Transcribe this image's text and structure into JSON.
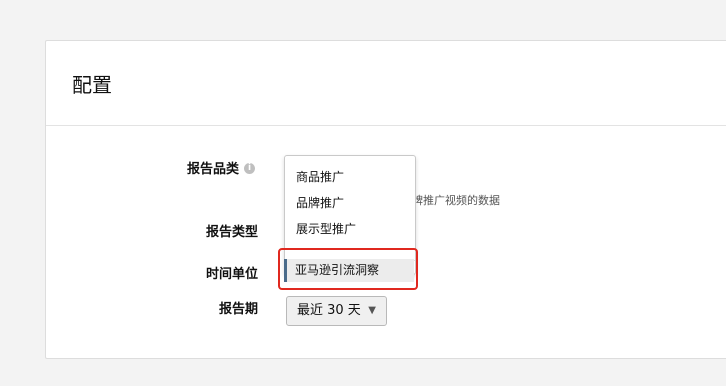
{
  "panel": {
    "title": "配置"
  },
  "fields": {
    "report_category": {
      "label": "报告品类",
      "helper_text": "牌推广视频的数据"
    },
    "report_type": {
      "label": "报告类型"
    },
    "time_unit": {
      "label": "时间单位"
    },
    "report_period": {
      "label": "报告期",
      "value": "最近 30 天"
    }
  },
  "dropdown": {
    "items": [
      "商品推广",
      "品牌推广",
      "展示型推广"
    ],
    "selected": "亚马逊引流洞察"
  },
  "colors": {
    "highlight": "#e0281f",
    "selected_bar": "#4a6b8a"
  }
}
